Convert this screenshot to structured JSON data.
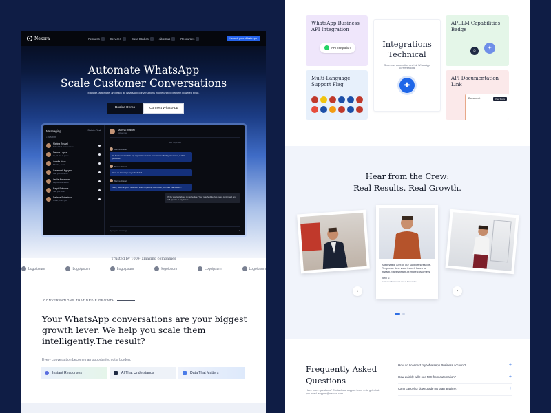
{
  "left": {
    "brand": "Nexora",
    "nav": [
      "Features",
      "Services",
      "Case Studies",
      "About us",
      "Resources"
    ],
    "nav_cta": "Launch your WhatsApp",
    "hero_title_1": "Automate WhatsApp",
    "hero_title_2": "Scale Customer Conversations",
    "hero_sub": "Manage, automate, and track all WhatsApp conversations in one unified platform powered by AI.",
    "btn_demo": "Book a Demo",
    "btn_connect": "Connect WhatsApp",
    "app": {
      "side_title": "Messaging",
      "side_action": "Switch Chat",
      "search": "Search",
      "contacts": [
        {
          "name": "Marina Russell",
          "preview": "Scheduled for tomorrow"
        },
        {
          "name": "Dennis Lopez",
          "preview": "Hi, I'd like to place"
        },
        {
          "name": "Amelia Hook",
          "preview": "Thanks, got it"
        },
        {
          "name": "Savannah Nguyen",
          "preview": "Can you confirm?"
        },
        {
          "name": "Leslie Alexander",
          "preview": "Payment received"
        },
        {
          "name": "Ralph Edwards",
          "preview": "See you soon"
        },
        {
          "name": "Darlene Robertson",
          "preview": "Great, thank you"
        }
      ],
      "chat_name": "Marina Russell",
      "chat_status": "Active now",
      "chat_date": "Mar 14, 2025",
      "messages_in": [
        {
          "sender": "Marina Russell",
          "text": "I'd like to reschedule my appointment from tomorrow to Friday afternoon, is that possible?"
        },
        {
          "sender": "Marina Russell",
          "text": "How do I manage my schedule?"
        },
        {
          "sender": "Marina Russell",
          "text": "Sure, but I've got a new item that I'm getting soon. Are you sure that'll work?"
        }
      ],
      "message_out": "I'll be worried about my schedule. Your reschedule has been confirmed and will update in my Inbox.",
      "compose": "Type your message..."
    },
    "trusted": "Trusted by 100+ amazing companies",
    "logos": [
      "Logoipsum",
      "Logoipsum",
      "Logoipsum",
      "logoipsum",
      "Logoipsum",
      "Logoipsum"
    ],
    "eyebrow": "CONVERSATIONS THAT DRIVE GROWTH",
    "big_q": "Your WhatsApp conversations are your biggest growth lever. We help you scale them intelligently.The result?",
    "small_note": "Every conversation becomes an opportunity, not a burden.",
    "chips": [
      "Instant Responses",
      "AI That Understands",
      "Data That Matters"
    ]
  },
  "right": {
    "card_wa": "WhatsApp Business API Integration",
    "pill_int": "API Integration",
    "card_center_1": "Integrations",
    "card_center_2": "Technical",
    "card_center_sub": "Seamless automation and full WhatsApp conversations",
    "card_ai": "AI/LLM Capabilities Badge",
    "card_lang": "Multi-Language Support Flag",
    "card_doc": "API Documentation Link",
    "doc_title": "Document",
    "doc_btn": "View Docs",
    "crew_title_1": "Hear from the Crew:",
    "crew_title_2": "Real Results. Real Growth.",
    "quote": "Automated 70% of our support sessions. Response time went from 4 hours to instant. Saves team 3x more customers.",
    "quote_name": "John D.",
    "quote_role": "Customer Success Lead at FintechCo",
    "faq_title_1": "Frequently Asked",
    "faq_title_2": "Questions",
    "faq_note": "Have more questions? Contact our support team — to get what you need. support@nexora.com",
    "faqs": [
      "How do I connect my WhatsApp Business account?",
      "How quickly will I see ROI from automation?",
      "Can I cancel or downgrade my plan anytime?"
    ]
  },
  "colors": {
    "page_bg": "#0f1d45",
    "accent": "#2563eb",
    "whatsapp": "#25d366"
  },
  "flags": [
    "#c0392b",
    "#f1c40f",
    "#c0392b",
    "#1d4fa8",
    "#1d4fa8",
    "#c0392b",
    "#e74c3c",
    "#1d4fa8",
    "#f39c12",
    "#c0392b",
    "#1d4fa8",
    "#c0392b"
  ]
}
